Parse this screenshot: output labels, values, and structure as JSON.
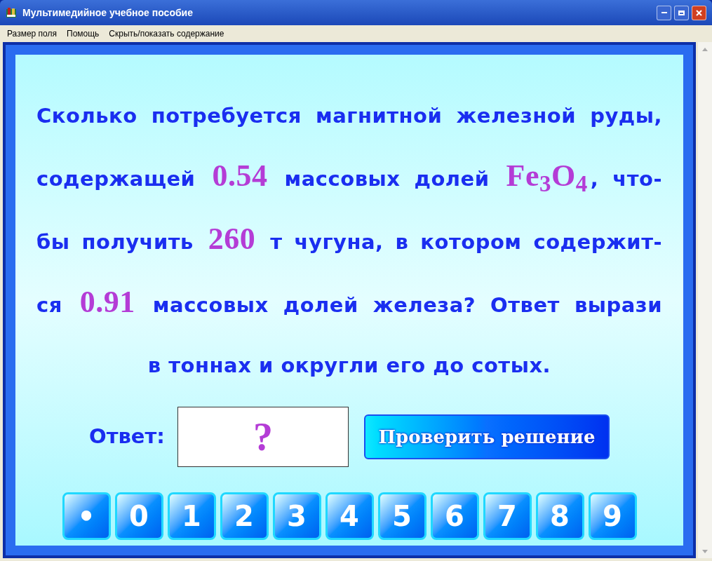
{
  "window": {
    "title": "Мультимедийное учебное пособие"
  },
  "menu": [
    "Размер поля",
    "Помощь",
    "Скрыть/показать содержание"
  ],
  "question": {
    "lines": [
      [
        {
          "kind": "text",
          "text": "Сколько потребуется магнитной железной руды,"
        }
      ],
      [
        {
          "kind": "text",
          "text": "содержащей "
        },
        {
          "kind": "value",
          "text": "0.54"
        },
        {
          "kind": "text",
          "text": " массовых долей "
        },
        {
          "kind": "value",
          "text": "Fe$_{3}$O$_{4}$"
        },
        {
          "kind": "text",
          "text": ", что-"
        }
      ],
      [
        {
          "kind": "text",
          "text": "бы получить "
        },
        {
          "kind": "value",
          "text": "260"
        },
        {
          "kind": "text",
          "text": " т чугуна, в котором содержит-"
        }
      ],
      [
        {
          "kind": "text",
          "text": "ся "
        },
        {
          "kind": "value",
          "text": "0.91"
        },
        {
          "kind": "text",
          "text": " массовых долей железа? Ответ вырази"
        }
      ],
      [
        {
          "kind": "text",
          "text": "в тоннах и округли его до сотых."
        }
      ]
    ]
  },
  "answer": {
    "label": "Ответ:",
    "value": "?"
  },
  "check_button": "Проверить решение",
  "keypad": [
    "•",
    "0",
    "1",
    "2",
    "3",
    "4",
    "5",
    "6",
    "7",
    "8",
    "9"
  ]
}
